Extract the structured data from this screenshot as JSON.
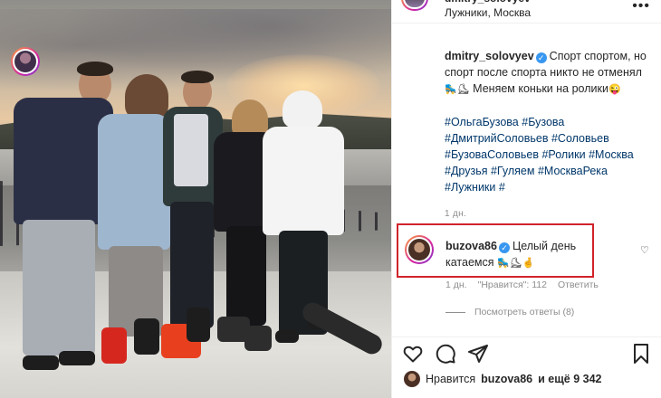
{
  "post": {
    "top_username": "dmitry_solovyev",
    "location": "Лужники, Москва",
    "more_icon": "more-dots-icon"
  },
  "caption": {
    "username": "dmitry_solovyev",
    "text_part1": "Спорт спортом, но спорт после спорта никто не отменял",
    "text_part2": "Меняем коньки на ролики",
    "emoji_skates": "🛼⛸",
    "emoji_tongue": "😜",
    "hashtags": [
      "#ОльгаБузова",
      "#Бузова",
      "#ДмитрийСоловьев",
      "#Соловьев",
      "#БузоваСоловьев",
      "#Ролики",
      "#Москва",
      "#Друзья",
      "#Гуляем",
      "#МоскваРека",
      "#Лужники",
      "#"
    ],
    "time": "1 дн."
  },
  "comment": {
    "username": "buzova86",
    "text": "Целый день катаемся",
    "emoji": "🛼⛸🤞",
    "time": "1 дн.",
    "likes_label": "\"Нравится\": 112",
    "reply_label": "Ответить",
    "view_replies": "Посмотреть ответы (8)"
  },
  "actions": {
    "like_icon": "heart-icon",
    "comment_icon": "comment-icon",
    "share_icon": "share-icon",
    "save_icon": "bookmark-icon"
  },
  "likes": {
    "prefix": "Нравится",
    "user": "buzova86",
    "and_more": "и ещё 9 342"
  },
  "colors": {
    "highlight_border": "#d0232a",
    "hashtag": "#00376b",
    "verified": "#3897f0",
    "muted": "#8e8e8e"
  }
}
